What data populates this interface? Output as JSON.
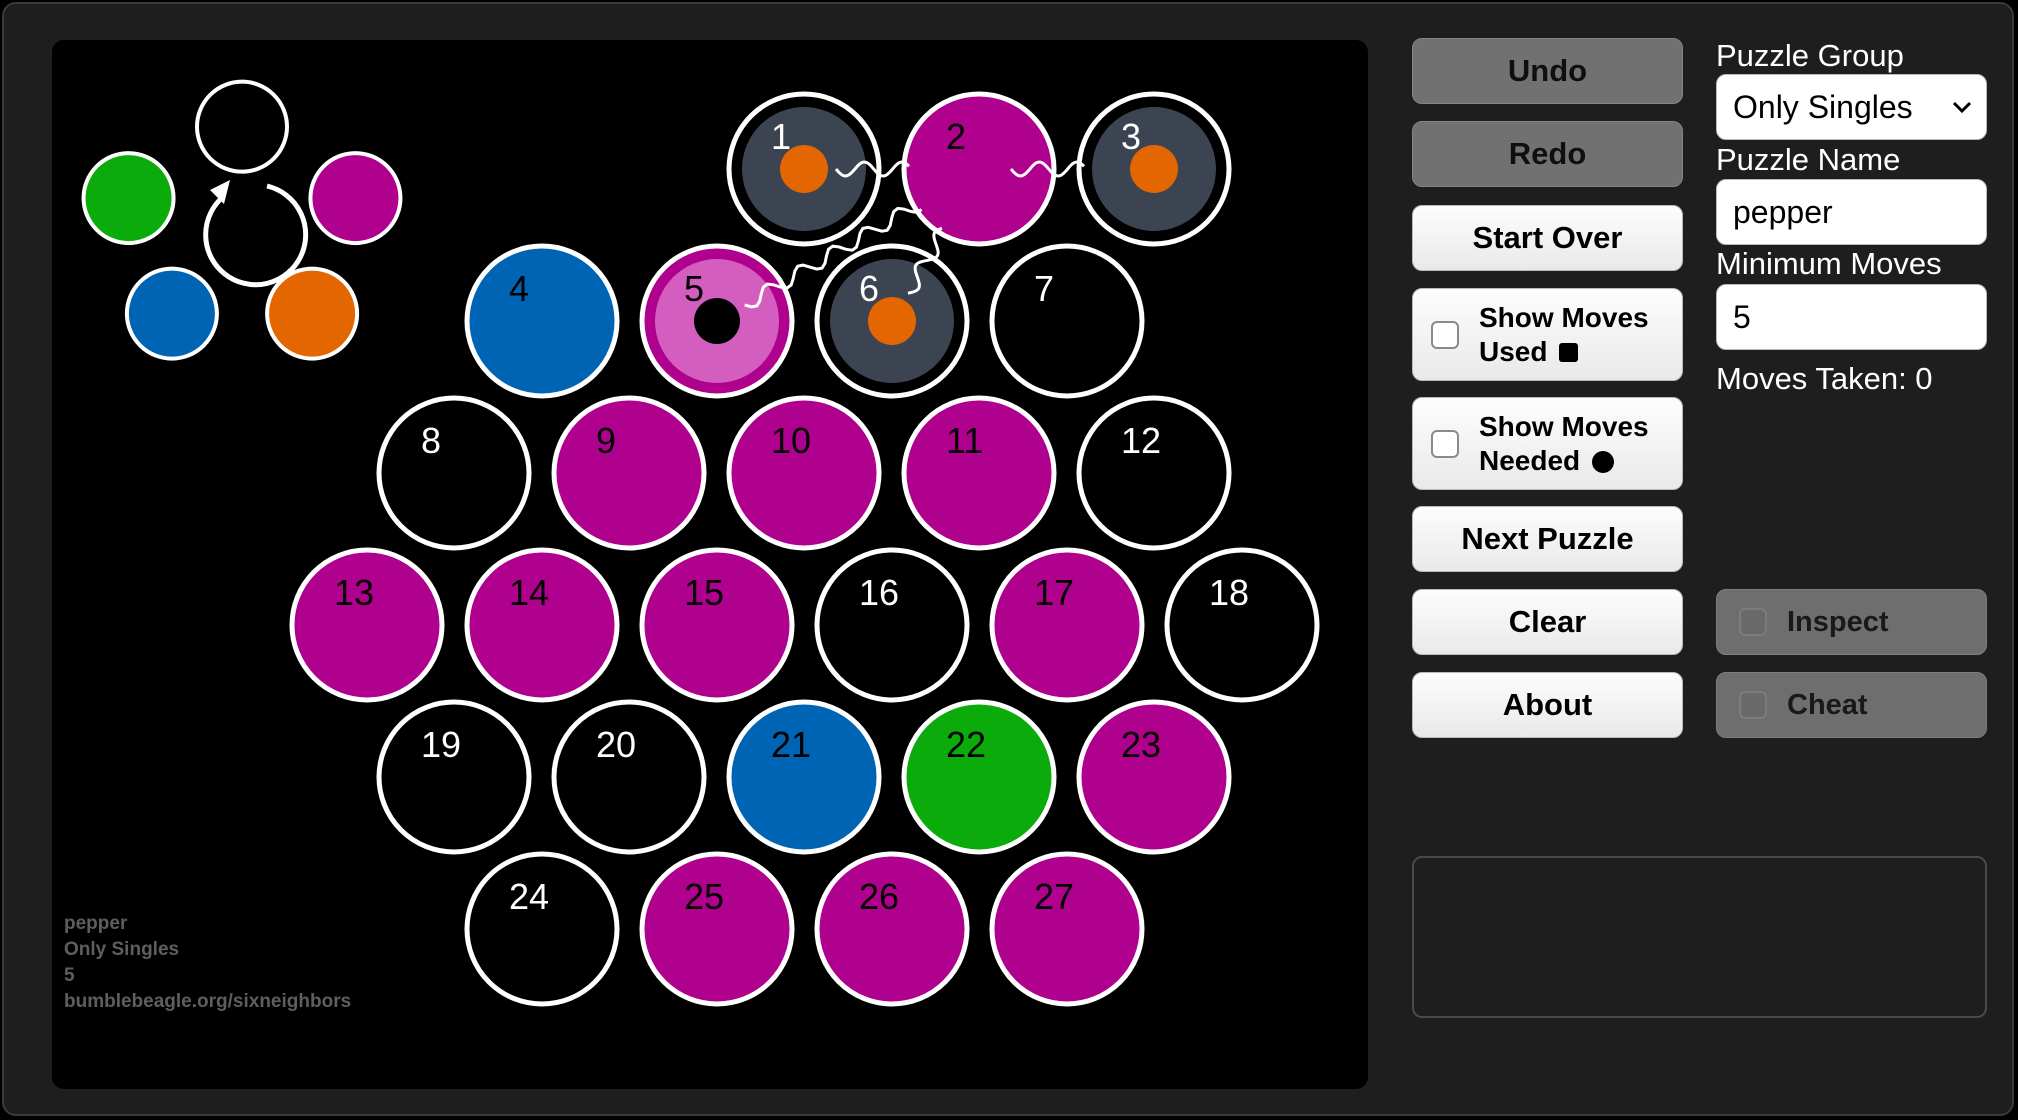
{
  "board": {
    "colors": {
      "magenta": "#b0008e",
      "blue": "#0064b4",
      "green": "#0cab0c",
      "orange": "#e36600",
      "gray": "#3c4452",
      "light_magenta": "#d45dc0",
      "empty": "#000000",
      "outline": "#ffffff"
    },
    "palette": [
      {
        "name": "empty",
        "fill": "#000000"
      },
      {
        "name": "magenta",
        "fill": "#b0008e"
      },
      {
        "name": "orange",
        "fill": "#e36600"
      },
      {
        "name": "blue",
        "fill": "#0064b4"
      },
      {
        "name": "green",
        "fill": "#0cab0c"
      }
    ],
    "cells": [
      {
        "num": "1",
        "row": 0,
        "col": 1,
        "state": "link"
      },
      {
        "num": "2",
        "row": 0,
        "col": 2,
        "state": "magenta"
      },
      {
        "num": "3",
        "row": 0,
        "col": 3,
        "state": "link"
      },
      {
        "num": "4",
        "row": 1,
        "col": 0,
        "state": "blue"
      },
      {
        "num": "5",
        "row": 1,
        "col": 1,
        "state": "selected"
      },
      {
        "num": "6",
        "row": 1,
        "col": 2,
        "state": "link"
      },
      {
        "num": "7",
        "row": 1,
        "col": 3,
        "state": "empty"
      },
      {
        "num": "8",
        "row": 2,
        "col": 0,
        "state": "empty"
      },
      {
        "num": "9",
        "row": 2,
        "col": 1,
        "state": "magenta"
      },
      {
        "num": "10",
        "row": 2,
        "col": 2,
        "state": "magenta"
      },
      {
        "num": "11",
        "row": 2,
        "col": 3,
        "state": "magenta"
      },
      {
        "num": "12",
        "row": 2,
        "col": 4,
        "state": "empty"
      },
      {
        "num": "13",
        "row": 3,
        "col": 0,
        "state": "magenta"
      },
      {
        "num": "14",
        "row": 3,
        "col": 1,
        "state": "magenta"
      },
      {
        "num": "15",
        "row": 3,
        "col": 2,
        "state": "magenta"
      },
      {
        "num": "16",
        "row": 3,
        "col": 3,
        "state": "empty"
      },
      {
        "num": "17",
        "row": 3,
        "col": 4,
        "state": "magenta"
      },
      {
        "num": "18",
        "row": 3,
        "col": 5,
        "state": "empty"
      },
      {
        "num": "19",
        "row": 4,
        "col": 0,
        "state": "empty"
      },
      {
        "num": "20",
        "row": 4,
        "col": 1,
        "state": "empty"
      },
      {
        "num": "21",
        "row": 4,
        "col": 2,
        "state": "blue"
      },
      {
        "num": "22",
        "row": 4,
        "col": 3,
        "state": "green"
      },
      {
        "num": "23",
        "row": 4,
        "col": 4,
        "state": "magenta"
      },
      {
        "num": "24",
        "row": 5,
        "col": 0,
        "state": "empty"
      },
      {
        "num": "25",
        "row": 5,
        "col": 1,
        "state": "magenta"
      },
      {
        "num": "26",
        "row": 5,
        "col": 2,
        "state": "magenta"
      },
      {
        "num": "27",
        "row": 5,
        "col": 3,
        "state": "magenta"
      }
    ],
    "links": [
      [
        "1",
        "2"
      ],
      [
        "2",
        "3"
      ],
      [
        "5",
        "2"
      ],
      [
        "6",
        "2"
      ]
    ],
    "footer": {
      "puzzle_name": "pepper",
      "puzzle_group": "Only Singles",
      "min_moves": "5",
      "site": "bumblebeagle.org/sixneighbors"
    }
  },
  "controls": {
    "undo": "Undo",
    "redo": "Redo",
    "start_over": "Start Over",
    "show_moves_used_line1": "Show Moves",
    "show_moves_used_line2": "Used",
    "show_moves_needed_line1": "Show Moves",
    "show_moves_needed_line2": "Needed",
    "next_puzzle": "Next Puzzle",
    "clear": "Clear",
    "about": "About"
  },
  "sidebar": {
    "puzzle_group_label": "Puzzle Group",
    "puzzle_group_value": "Only Singles",
    "puzzle_name_label": "Puzzle Name",
    "puzzle_name_value": "pepper",
    "minimum_moves_label": "Minimum Moves",
    "minimum_moves_value": "5",
    "moves_taken": "Moves Taken: 0",
    "inspect": "Inspect",
    "cheat": "Cheat"
  }
}
